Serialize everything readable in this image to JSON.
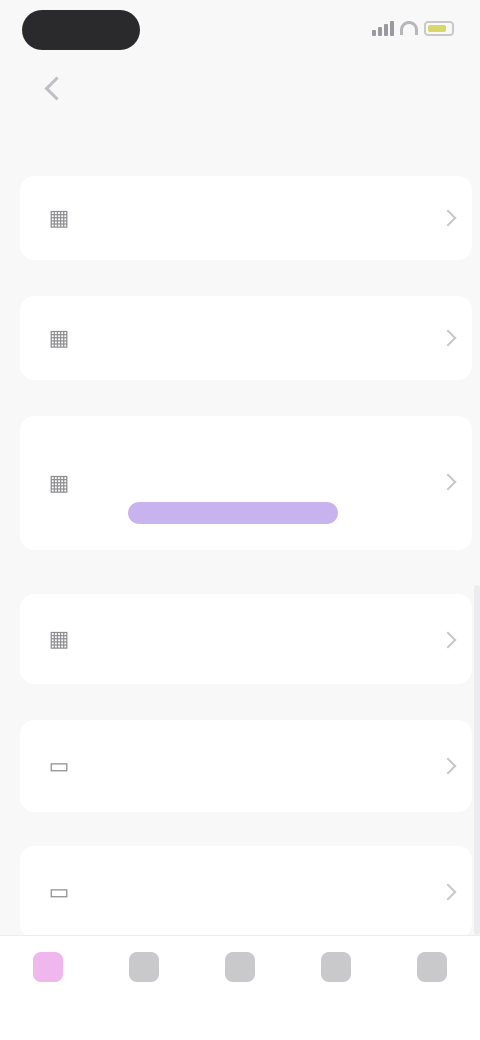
{
  "status_bar": {
    "time": "",
    "battery_color": "#d8d86a"
  },
  "header": {
    "title": "",
    "back_icon": "chevron-left-icon"
  },
  "items": [
    {
      "title": "",
      "subtitle": "",
      "icon": "notebook-icon"
    },
    {
      "title": "",
      "subtitle": "",
      "icon": "notebook-icon"
    },
    {
      "title": "",
      "subtitle": "",
      "badge": "",
      "icon": "notebook-icon"
    },
    {
      "title": "",
      "subtitle": "",
      "icon": "notebook-icon"
    },
    {
      "title": "",
      "subtitle": "",
      "icon": "cards-icon"
    },
    {
      "title": "",
      "subtitle": "",
      "icon": "cards-icon"
    }
  ],
  "tabs": [
    {
      "label": "",
      "active": true,
      "icon": "home-icon"
    },
    {
      "label": "",
      "active": false,
      "icon": "book-icon"
    },
    {
      "label": "",
      "active": false,
      "icon": "chart-icon"
    },
    {
      "label": "",
      "active": false,
      "icon": "practice-icon"
    },
    {
      "label": "",
      "active": false,
      "icon": "profile-icon"
    }
  ],
  "colors": {
    "accent_tab": "#f0b6ee",
    "badge_bg": "#c9b3ee",
    "badge_text": "#7a4ccf"
  }
}
